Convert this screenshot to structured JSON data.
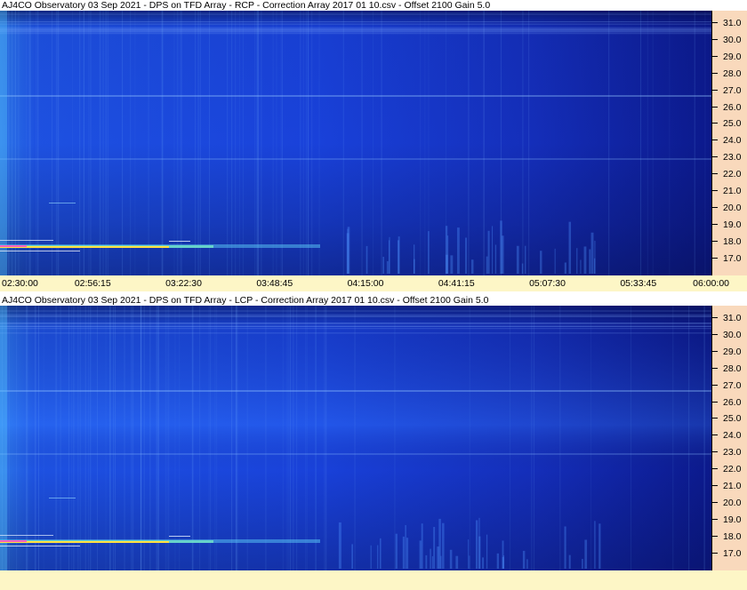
{
  "top_panel": {
    "title": "AJ4CO Observatory 03 Sep 2021  -  DPS on TFD Array  -  RCP  -  Correction Array 2017 01 10.csv  -  Offset 2100  Gain 5.0"
  },
  "bottom_panel": {
    "title": "AJ4CO Observatory 03 Sep 2021  -  DPS on TFD Array  -  LCP  -  Correction Array 2017 01 10.csv  -  Offset 2100  Gain 5.0"
  },
  "freq_ticks": [
    "31.0",
    "30.0",
    "29.0",
    "28.0",
    "27.0",
    "26.0",
    "25.0",
    "24.0",
    "23.0",
    "22.0",
    "21.0",
    "20.0",
    "19.0",
    "18.0",
    "17.0"
  ],
  "time_ticks": [
    "02:30:00",
    "02:56:15",
    "03:22:30",
    "03:48:45",
    "04:15:00",
    "04:41:15",
    "05:07:30",
    "05:33:45",
    "06:00:00"
  ],
  "colors": {
    "spectrogram_base": "#1a3fe0",
    "spectrogram_dark": "#0a1a80",
    "spectrogram_bright": "#3a8cff",
    "burst_yellow": "#ffe040",
    "freq_axis_bg": "#f9d9bc",
    "time_axis_bg": "#fdf6c6"
  }
}
